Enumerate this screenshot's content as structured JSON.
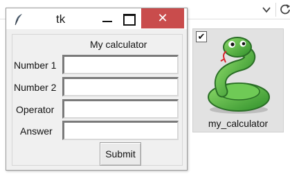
{
  "window": {
    "title": "tk",
    "close_glyph": "✕"
  },
  "form": {
    "header": "My calculator",
    "fields": [
      {
        "label": "Number 1",
        "value": ""
      },
      {
        "label": "Number 2",
        "value": ""
      },
      {
        "label": "Operator",
        "value": ""
      },
      {
        "label": "Answer",
        "value": ""
      }
    ],
    "submit_label": "Submit"
  },
  "taskbar_item": {
    "label": "my_calculator",
    "checkbox_glyph": "✔",
    "checked": true,
    "icon": "python-snake-icon"
  },
  "colors": {
    "close_button": "#c94c4c",
    "window_bg": "#f0f0f0",
    "snake_green": "#4fb848"
  }
}
